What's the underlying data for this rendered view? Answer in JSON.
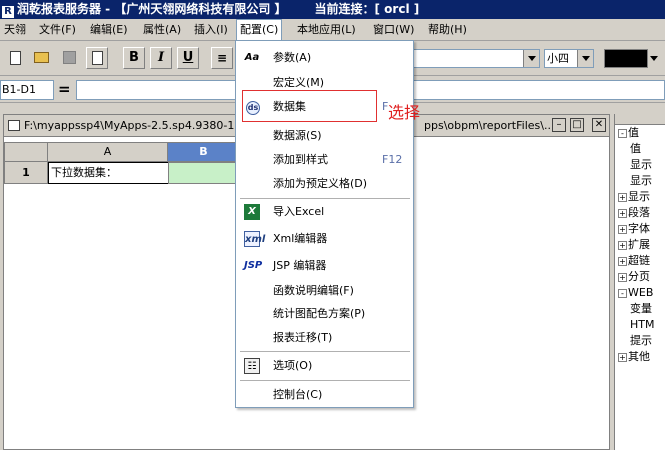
{
  "window": {
    "title": "润乾报表服务器 - 【广州天翎网络科技有限公司 】",
    "connection": "当前连接：[ orcl ]"
  },
  "menubar": {
    "items": [
      {
        "label": "天翎"
      },
      {
        "label": "文件(F)"
      },
      {
        "label": "编辑(E)"
      },
      {
        "label": "属性(A)"
      },
      {
        "label": "插入(I)"
      },
      {
        "label": "配置(C)"
      },
      {
        "label": "本地应用(L)"
      },
      {
        "label": "窗口(W)"
      },
      {
        "label": "帮助(H)"
      }
    ]
  },
  "toolbar": {
    "bold": "B",
    "italic": "I",
    "underline": "U",
    "font_size": "小四"
  },
  "formula": {
    "cell_ref": "B1-D1",
    "eq": "="
  },
  "document": {
    "title": "F:\\myappssp4\\MyApps-2.5.sp4.9380-1",
    "title_tail": "pps\\obpm\\reportFiles\\...",
    "columns": [
      "A",
      "B"
    ],
    "row_number": "1",
    "cell_a1": "下拉数据集："
  },
  "tree_panel": {
    "rows": [
      {
        "exp": "-",
        "text": "值",
        "level": 0
      },
      {
        "exp": "",
        "text": "值",
        "level": 1
      },
      {
        "exp": "",
        "text": "显示",
        "level": 1
      },
      {
        "exp": "",
        "text": "显示",
        "level": 1
      },
      {
        "exp": "+",
        "text": "显示",
        "level": 0
      },
      {
        "exp": "+",
        "text": "段落",
        "level": 0
      },
      {
        "exp": "+",
        "text": "字体",
        "level": 0
      },
      {
        "exp": "+",
        "text": "扩展",
        "level": 0
      },
      {
        "exp": "+",
        "text": "超链",
        "level": 0
      },
      {
        "exp": "+",
        "text": "分页",
        "level": 0
      },
      {
        "exp": "-",
        "text": "WEB",
        "level": 0
      },
      {
        "exp": "",
        "text": "变量",
        "level": 1
      },
      {
        "exp": "",
        "text": "HTM",
        "level": 1
      },
      {
        "exp": "",
        "text": "提示",
        "level": 1
      },
      {
        "exp": "+",
        "text": "其他",
        "level": 0
      }
    ]
  },
  "config_menu": {
    "items": [
      {
        "label": "参数(A)",
        "icon": "params-icon",
        "glyph": "Aa"
      },
      {
        "label": "宏定义(M)",
        "icon": "",
        "glyph": ""
      },
      {
        "label": "数据集",
        "icon": "dataset-icon",
        "glyph": "ds",
        "shortcut": "F"
      },
      {
        "label": "数据源(S)",
        "icon": "",
        "glyph": ""
      },
      {
        "label": "添加到样式",
        "icon": "",
        "glyph": "",
        "shortcut": "F12"
      },
      {
        "label": "添加为预定义格(D)",
        "icon": "",
        "glyph": ""
      },
      {
        "label": "导入Excel",
        "icon": "excel-icon",
        "glyph": "X"
      },
      {
        "label": "Xml编辑器",
        "icon": "xml-icon",
        "glyph": "xml"
      },
      {
        "label": "JSP 编辑器",
        "icon": "jsp-icon",
        "glyph": "JSP"
      },
      {
        "label": "函数说明编辑(F)",
        "icon": "",
        "glyph": ""
      },
      {
        "label": "统计图配色方案(P)",
        "icon": "",
        "glyph": ""
      },
      {
        "label": "报表迁移(T)",
        "icon": "",
        "glyph": ""
      },
      {
        "label": "选项(O)",
        "icon": "options-icon",
        "glyph": "☷"
      },
      {
        "label": "控制台(C)",
        "icon": "",
        "glyph": ""
      }
    ]
  },
  "annotation": {
    "text": "选择",
    "color": "#e02020"
  },
  "colors": {
    "titlebar": "#0a246a",
    "selected_column": "#5b82c8",
    "cell_green": "#c8f0c8"
  }
}
